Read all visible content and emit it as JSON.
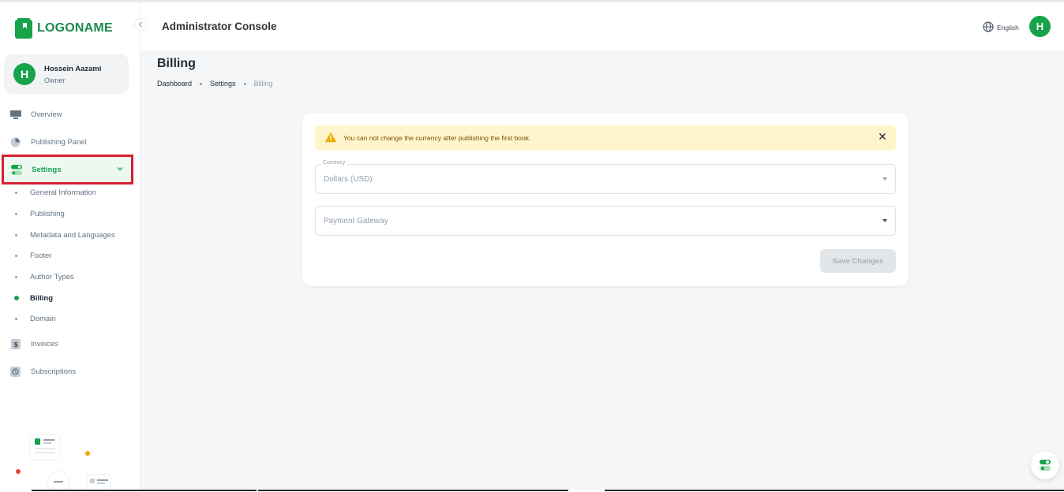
{
  "brand": {
    "logo_text": "LOGONAME",
    "accent": "#16a34a",
    "logo_color": "#1d8a4a"
  },
  "user": {
    "initial": "H",
    "name": "Hossein Aazami",
    "role": "Owner"
  },
  "sidebar": {
    "items": [
      {
        "label": "Overview",
        "icon": "monitor-icon"
      },
      {
        "label": "Publishing Panel",
        "icon": "dashboard-gauge-icon"
      },
      {
        "label": "Settings",
        "icon": "toggle-settings-icon",
        "active": true
      },
      {
        "label": "Invoices",
        "icon": "invoice-dollar-icon"
      },
      {
        "label": "Subscriptions",
        "icon": "subscription-icon"
      }
    ],
    "settings_sub": [
      {
        "label": "General Information"
      },
      {
        "label": "Publishing"
      },
      {
        "label": "Metadata and Languages"
      },
      {
        "label": "Footer"
      },
      {
        "label": "Author Types"
      },
      {
        "label": "Billing",
        "active": true
      },
      {
        "label": "Domain"
      }
    ]
  },
  "header": {
    "title": "Administrator Console",
    "language": "English",
    "avatar_initial": "H"
  },
  "page": {
    "title": "Billing",
    "breadcrumb": [
      "Dashboard",
      "Settings",
      "Billing"
    ]
  },
  "billing_form": {
    "alert_text": "You can not change the currency after publishing the first book.",
    "currency_label": "Currency",
    "currency_value": "Dollars (USD)",
    "gateway_placeholder": "Payment Gateway",
    "save_label": "Save Changes"
  },
  "colors": {
    "alert_bg": "#fff5cc",
    "alert_icon": "#f0a800",
    "highlight_border": "#d7202c"
  }
}
